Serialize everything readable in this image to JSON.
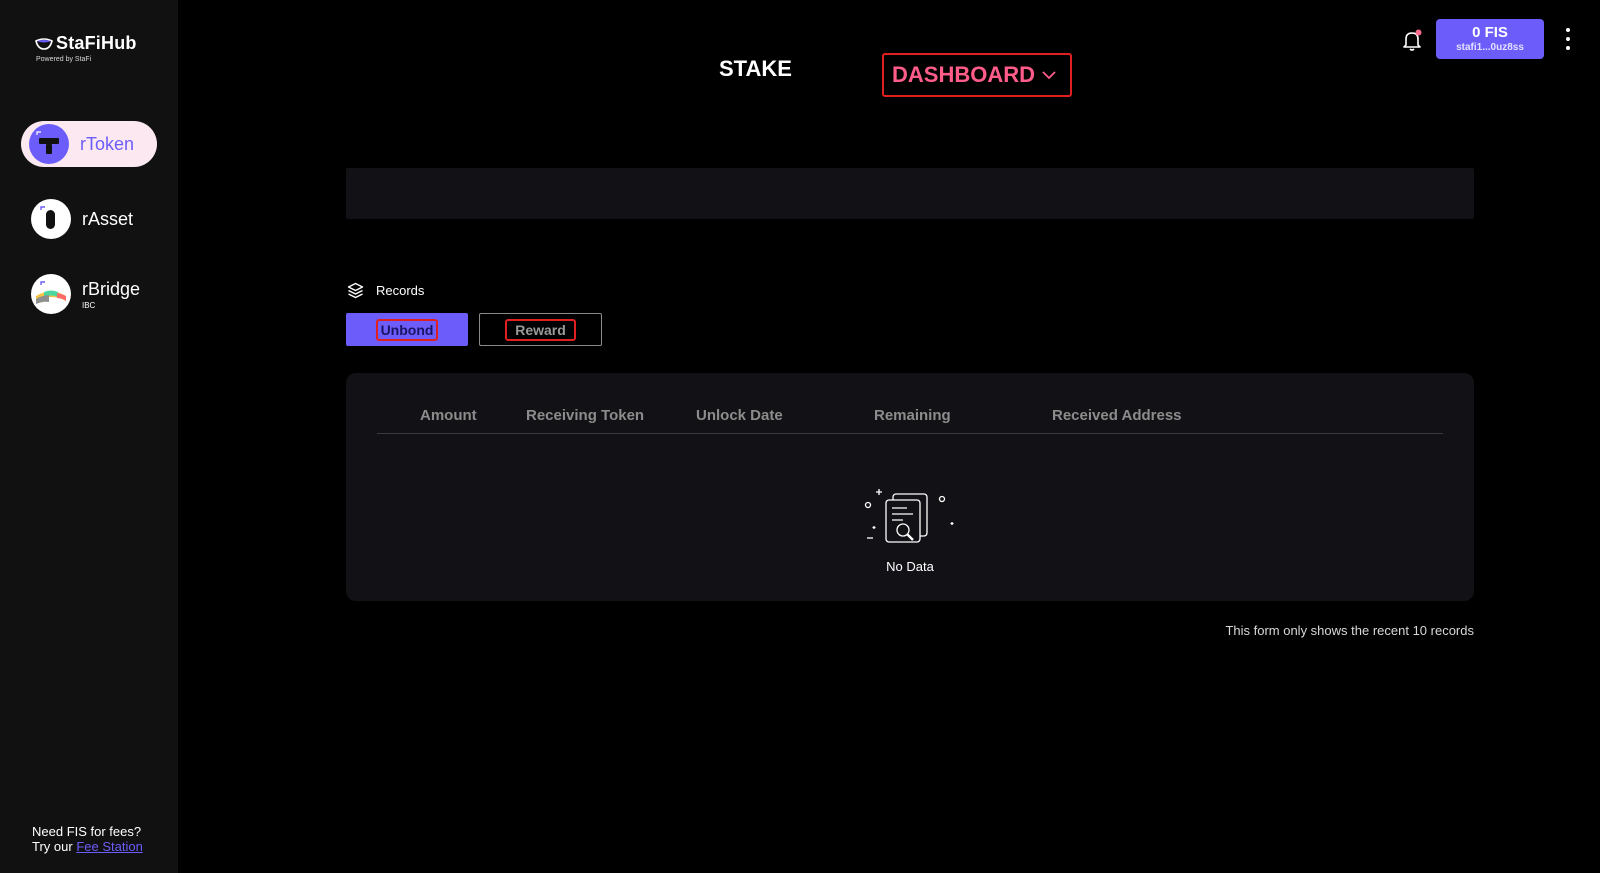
{
  "brand": {
    "name": "StaFiHub",
    "subtitle": "Powered by StaFi"
  },
  "sidebar": {
    "items": [
      {
        "label": "rToken",
        "sub": "",
        "active": true
      },
      {
        "label": "rAsset",
        "sub": "",
        "active": false
      },
      {
        "label": "rBridge",
        "sub": "IBC",
        "active": false
      }
    ],
    "fee_note_line1": "Need FIS for fees?",
    "fee_note_line2_prefix": "Try our",
    "fee_note_link": "Fee Station"
  },
  "header": {
    "tabs": [
      {
        "label": "STAKE"
      },
      {
        "label": "DASHBOARD"
      }
    ],
    "wallet": {
      "amount": "0 FIS",
      "address": "stafi1...0uz8ss"
    }
  },
  "records": {
    "title": "Records",
    "buttons": {
      "unbond": "Unbond",
      "reward": "Reward"
    },
    "columns": [
      "Amount",
      "Receiving Token",
      "Unlock Date",
      "Remaining",
      "Received Address"
    ],
    "empty_text": "No Data",
    "footnote": "This form only shows the recent 10 records"
  },
  "colors": {
    "accent": "#6c5dfa",
    "dashboard_tab": "#ff5c8a",
    "highlight_box": "#e02020",
    "sidebar_bg": "#111111",
    "card_bg": "#121216"
  },
  "icons": {
    "logo": "stafi-logo-icon",
    "rtoken": "rtoken-icon",
    "rasset": "rasset-icon",
    "rbridge": "rbridge-icon",
    "dashboard_chevron": "chevron-down-icon",
    "bell": "bell-icon",
    "more": "more-vertical-icon",
    "records": "layers-icon",
    "empty": "document-search-icon"
  }
}
